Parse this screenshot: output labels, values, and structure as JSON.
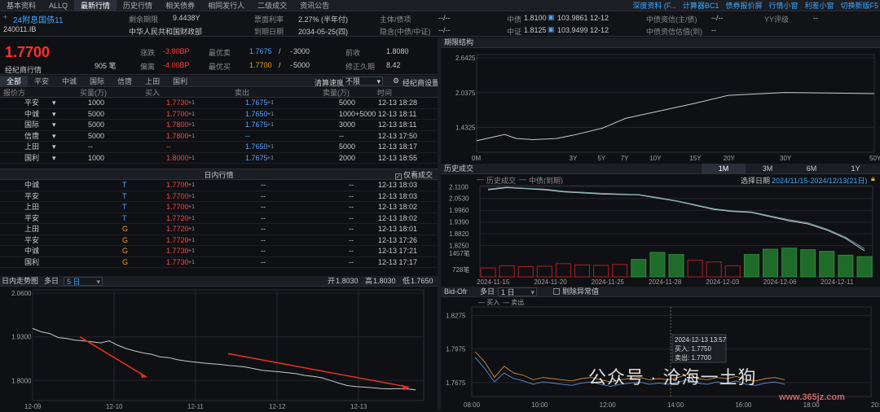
{
  "topbar": {
    "tabs": [
      "基本资料",
      "ALLQ",
      "最新行情",
      "历史行情",
      "相关债券",
      "相同发行人",
      "二级成交",
      "资讯公告"
    ],
    "active_index": 2,
    "right_links": [
      "深度资料 (F...",
      "计算器BC1",
      "债券报价屏",
      "行情小窗",
      "利差小窗",
      "切换新版F5"
    ]
  },
  "info": {
    "bond_name": "24附息国债11",
    "bond_code": "240011.IB",
    "remaining_label": "剩余期限",
    "remaining_value": "9.4438Y",
    "issuer": "中华人民共和国财政部",
    "coupon_label": "票面利率",
    "coupon_value": "2.27% (半年付)",
    "maturity_label": "到期日期",
    "maturity_value": "2034-05-25(四)",
    "guarantor_label": "主体/债项",
    "guarantor_value": "--/--",
    "rating_label": "隐含(中债/中证)",
    "rating_value": "--/--",
    "cb_label": "中债",
    "cb_yield": "1.8100",
    "cb_price": "103.9861",
    "cb_date": "12-12",
    "cs_label": "中证",
    "cs_yield": "1.8125",
    "cs_price": "103.9499",
    "cs_date": "12-12",
    "cb_rating_label": "中债资信(主/债)",
    "cb_rating_value": "--/--",
    "cb_est_label": "中债资信估值(到)",
    "cb_est_value": "--",
    "yy_label": "YY评级",
    "yy_value": "--"
  },
  "quote": {
    "price": "1.7700",
    "broker_label": "经纪商行情",
    "volume": "905 笔",
    "change_label": "涨跌",
    "change_value": "-3.80BP",
    "dev_label": "偏离",
    "dev_value": "-4.00BP",
    "best_sell_label": "最优卖",
    "best_sell_price": "1.7675",
    "best_sell_vol": "3000",
    "best_buy_label": "最优买",
    "best_buy_price": "1.7700",
    "best_buy_vol": "5000",
    "slash": "/",
    "dash": "-",
    "prev_close_label": "前收",
    "prev_close_value": "1.8080",
    "duration_label": "修正久期",
    "duration_value": "8.42"
  },
  "brokers": {
    "tabs": [
      "全部",
      "平安",
      "中诚",
      "国际",
      "信唐",
      "上田",
      "国利"
    ],
    "clear_label": "清算速度",
    "clear_value": "不限",
    "settings_label": "经纪商设置"
  },
  "quote_table": {
    "headers": [
      "报价方",
      "买量(万)",
      "买入",
      "卖出",
      "卖量(万)",
      "时间"
    ],
    "rows": [
      {
        "broker": "平安",
        "bid_vol": "1000",
        "bid": "1.7730",
        "bid_sup": "+1",
        "ask": "1.7675",
        "ask_sup": "+1",
        "ask_vol": "5000",
        "time": "12-13 18:28"
      },
      {
        "broker": "中诚",
        "bid_vol": "5000",
        "bid": "1.7700",
        "bid_sup": "+1",
        "ask": "1.7650",
        "ask_sup": "+1",
        "ask_vol": "1000+5000",
        "time": "12-13 18:11"
      },
      {
        "broker": "国际",
        "bid_vol": "5000",
        "bid": "1.7800",
        "bid_sup": "+1",
        "ask": "1.7675",
        "ask_sup": "+1",
        "ask_vol": "3000",
        "time": "12-13 18:11"
      },
      {
        "broker": "信唐",
        "bid_vol": "5000",
        "bid": "1.7800",
        "bid_sup": "+1",
        "ask": "--",
        "ask_sup": "",
        "ask_vol": "--",
        "time": "12-13 17:50"
      },
      {
        "broker": "上田",
        "bid_vol": "--",
        "bid": "--",
        "bid_sup": "",
        "ask": "1.7650",
        "ask_sup": "+1",
        "ask_vol": "5000",
        "time": "12-13 18:17"
      },
      {
        "broker": "国利",
        "bid_vol": "1000",
        "bid": "1.8000",
        "bid_sup": "+1",
        "ask": "1.7675",
        "ask_sup": "+1",
        "ask_vol": "2000",
        "time": "12-13 18:55"
      }
    ]
  },
  "intraday": {
    "title": "日内行情",
    "only_deal_label": "仅看成交",
    "rows": [
      {
        "broker": "中诚",
        "flag": "T",
        "price": "1.7700",
        "sup": "+1",
        "c1": "--",
        "c2": "--",
        "time": "12-13 18:03"
      },
      {
        "broker": "平安",
        "flag": "T",
        "price": "1.7700",
        "sup": "+1",
        "c1": "--",
        "c2": "--",
        "time": "12-13 18:03"
      },
      {
        "broker": "上田",
        "flag": "T",
        "price": "1.7700",
        "sup": "+1",
        "c1": "--",
        "c2": "--",
        "time": "12-13 18:02"
      },
      {
        "broker": "平安",
        "flag": "T",
        "price": "1.7720",
        "sup": "+1",
        "c1": "--",
        "c2": "--",
        "time": "12-13 18:02"
      },
      {
        "broker": "上田",
        "flag": "G",
        "price": "1.7720",
        "sup": "+1",
        "c1": "--",
        "c2": "--",
        "time": "12-13 18:01"
      },
      {
        "broker": "平安",
        "flag": "G",
        "price": "1.7720",
        "sup": "+1",
        "c1": "--",
        "c2": "--",
        "time": "12-13 17:26"
      },
      {
        "broker": "中诚",
        "flag": "G",
        "price": "1.7730",
        "sup": "+1",
        "c1": "--",
        "c2": "--",
        "time": "12-13 17:21"
      },
      {
        "broker": "国利",
        "flag": "G",
        "price": "1.7730",
        "sup": "+1",
        "c1": "--",
        "c2": "--",
        "time": "12-13 17:17"
      }
    ]
  },
  "trend_panel": {
    "title": "日内走势图",
    "days_label": "多日",
    "days_value": "5 日",
    "open_label": "开",
    "open_value": "1.8030",
    "high_label": "高",
    "high_value": "1.8030",
    "low_label": "低",
    "low_value": "1.7650"
  },
  "term_panel": {
    "title": "期限结构"
  },
  "history_panel": {
    "title": "历史成交",
    "ranges": [
      "1M",
      "3M",
      "6M",
      "1Y"
    ],
    "active_range": 0,
    "date_label": "选择日期",
    "date_value": "2024/11/15-2024/12/13(21日)",
    "legend_hist": "历史成交",
    "legend_cb": "中债(到期)"
  },
  "bidofr_panel": {
    "title": "Bid-Ofr",
    "days_label": "多日",
    "days_value": "1 日",
    "remove_label": "剔除异常值",
    "legend_buy": "买入",
    "legend_sell": "卖出",
    "tooltip_time": "2024-12-13 13:57",
    "tooltip_buy": "买入: 1.7750",
    "tooltip_sell": "卖出: 1.7700"
  },
  "watermark": {
    "text": "公众号 · 沧海一土狗",
    "site": "www.365jz.com"
  },
  "chart_data": [
    {
      "type": "line",
      "title": "日内走势图",
      "x_ticks": [
        "12-09",
        "12-10",
        "12-11",
        "12-12",
        "12-13"
      ],
      "y_ticks": [
        2.06,
        1.93,
        1.8
      ],
      "ylim": [
        1.74,
        2.07
      ],
      "series": [
        {
          "values": [
            1.955,
            1.945,
            1.94,
            1.928,
            1.925,
            1.92,
            1.918,
            1.915,
            1.912,
            1.918,
            1.905,
            1.895,
            1.888,
            1.882,
            1.878,
            1.87,
            1.868,
            1.862,
            1.858,
            1.855,
            1.852,
            1.85,
            1.848,
            1.845,
            1.843,
            1.84,
            1.835,
            1.83,
            1.828,
            1.826,
            1.823,
            1.82,
            1.815,
            1.812,
            1.808,
            1.8,
            1.792,
            1.785,
            1.782,
            1.78,
            1.778,
            1.776,
            1.775,
            1.776,
            1.775,
            1.772
          ]
        }
      ]
    },
    {
      "type": "line",
      "title": "期限结构",
      "x_ticks": [
        "0M",
        "3Y",
        "5Y",
        "7Y",
        "10Y",
        "15Y",
        "20Y",
        "30Y",
        "50Y"
      ],
      "x_values": [
        0,
        3,
        5,
        7,
        10,
        15,
        20,
        30,
        50
      ],
      "y_ticks": [
        2.6425,
        2.0375,
        1.4325
      ],
      "ylim": [
        1.0,
        2.7
      ],
      "series": [
        {
          "x": [
            0,
            0.25,
            0.5,
            1,
            2,
            3,
            5,
            7,
            10,
            15,
            20,
            30,
            50
          ],
          "values": [
            1.2,
            1.31,
            1.24,
            1.22,
            1.24,
            1.3,
            1.42,
            1.59,
            1.7,
            1.85,
            1.99,
            2.04,
            2.02
          ]
        }
      ]
    },
    {
      "type": "line",
      "title": "历史成交",
      "x_ticks": [
        "2024-11-15",
        "2024-11-20",
        "2024-11-25",
        "2024-11-28",
        "2024-12-03",
        "2024-12-06",
        "2024-12-11"
      ],
      "y_ticks": [
        2.11,
        2.053,
        1.996,
        1.939,
        1.882,
        1.825
      ],
      "series": [
        {
          "name": "历史成交",
          "values": [
            2.095,
            2.105,
            2.1,
            2.095,
            2.085,
            2.08,
            2.075,
            2.072,
            2.07,
            2.055,
            2.04,
            2.02,
            2.0,
            1.99,
            1.985,
            1.965,
            1.945,
            1.93,
            1.9,
            1.86,
            1.8
          ]
        },
        {
          "name": "中债(到期)",
          "values": [
            2.098,
            2.108,
            2.102,
            2.098,
            2.088,
            2.083,
            2.078,
            2.075,
            2.072,
            2.058,
            2.042,
            2.023,
            2.003,
            1.993,
            1.988,
            1.968,
            1.95,
            1.935,
            1.905,
            1.865,
            1.81
          ]
        }
      ],
      "volume_ticks": [
        "1457笔",
        "728笔"
      ],
      "volume": [
        420,
        520,
        480,
        500,
        620,
        560,
        540,
        580,
        820,
        1150,
        1050,
        780,
        700,
        520,
        1050,
        1300,
        1350,
        1280,
        1200,
        1020,
        950
      ]
    },
    {
      "type": "line",
      "title": "Bid-Ofr",
      "x_ticks": [
        "08:00",
        "10:00",
        "12:00",
        "14:00",
        "16:00",
        "18:00",
        "20:00"
      ],
      "y_ticks": [
        1.8275,
        1.7975,
        1.7675
      ],
      "ylim": [
        1.755,
        1.835
      ],
      "series": [
        {
          "name": "买入",
          "values": [
            1.795,
            1.786,
            1.772,
            1.782,
            1.776,
            1.774,
            1.77,
            1.772,
            1.771,
            1.77,
            1.769,
            1.771,
            1.772,
            1.77,
            1.768,
            1.77,
            1.771,
            1.772,
            1.77,
            1.771,
            1.77,
            1.772,
            1.775,
            1.771,
            1.77,
            1.772,
            1.771,
            1.773,
            1.77,
            1.769,
            1.771,
            1.772,
            1.77
          ]
        },
        {
          "name": "卖出",
          "values": [
            1.79,
            1.78,
            1.768,
            1.776,
            1.771,
            1.769,
            1.766,
            1.768,
            1.767,
            1.766,
            1.765,
            1.767,
            1.768,
            1.766,
            1.764,
            1.766,
            1.767,
            1.768,
            1.766,
            1.767,
            1.766,
            1.768,
            1.77,
            1.767,
            1.766,
            1.768,
            1.767,
            1.769,
            1.766,
            1.765,
            1.767,
            1.768,
            1.766
          ]
        }
      ]
    }
  ]
}
